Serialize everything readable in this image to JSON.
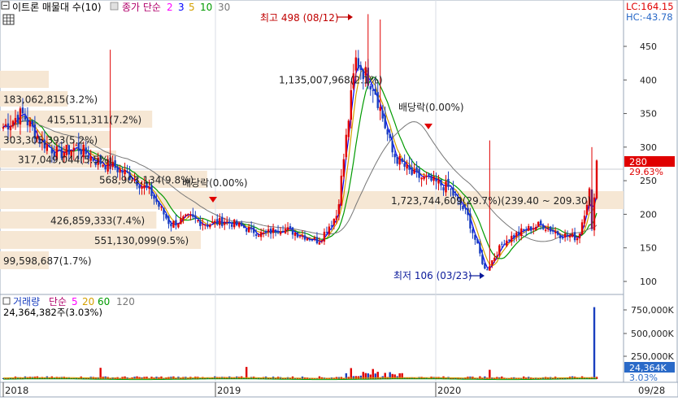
{
  "header": {
    "title": "이트론 매물대 수(10)",
    "ma_title": "종가 단순",
    "ma_periods": [
      "2",
      "3",
      "5",
      "10",
      "30"
    ],
    "ma_colors": [
      "#ff00ff",
      "#0000ff",
      "#d4a000",
      "#009a00",
      "#777777"
    ],
    "lc": "LC:164.15",
    "hc": "HC:-43.78"
  },
  "price_panel": {
    "y_ticks": [
      "450",
      "400",
      "350",
      "300",
      "250",
      "200",
      "150",
      "100"
    ],
    "current_price": "280",
    "current_change": "29.63%",
    "high_label": "최고 498 (08/12)",
    "low_label": "최저 106 (03/23)",
    "dividend_label": "배당락(0.00%)",
    "volume_profile": [
      {
        "label": "1,135,007,968(2.1%)",
        "level": 390
      },
      {
        "label": "183,062,815(3.2%)",
        "level": 365
      },
      {
        "label": "415,511,311(7.2%)",
        "level": 340
      },
      {
        "label": "303,305,393(5.2%)",
        "level": 315
      },
      {
        "label": "317,049,044(5.5%)",
        "level": 290
      },
      {
        "label": "568,903,134(9.8%)",
        "level": 265
      },
      {
        "label": "1,723,744,609(29.7%)(239.40 ~ 209.30)",
        "level": 240
      },
      {
        "label": "426,859,333(7.4%)",
        "level": 215
      },
      {
        "label": "551,130,099(9.5%)",
        "level": 190
      },
      {
        "label": "99,598,687(1.7%)",
        "level": 165
      }
    ]
  },
  "volume_panel": {
    "title": "거래량",
    "ma_title": "단순",
    "ma_periods": [
      "5",
      "20",
      "60",
      "120"
    ],
    "ma_colors": [
      "#ff00ff",
      "#d4a000",
      "#009a00",
      "#777777"
    ],
    "summary": "24,364,382주(3.03%)",
    "y_ticks": [
      "750,000K",
      "500,000K",
      "250,000K"
    ],
    "current_volume": "24,364K",
    "current_pct": "3.03%"
  },
  "x_axis": {
    "labels": [
      "2018",
      "2019",
      "2020",
      "09/28"
    ]
  },
  "chart_data": {
    "type": "candlestick",
    "title": "이트론",
    "ylim": [
      80,
      510
    ],
    "x_labels": [
      "2018",
      "2019",
      "2020",
      "09/28"
    ],
    "price_series": {
      "name": "종가",
      "points": [
        {
          "x": "2018-01",
          "y": 330
        },
        {
          "x": "2018-02",
          "y": 350
        },
        {
          "x": "2018-03",
          "y": 310
        },
        {
          "x": "2018-04",
          "y": 290
        },
        {
          "x": "2018-05",
          "y": 300
        },
        {
          "x": "2018-06",
          "y": 280
        },
        {
          "x": "2018-07",
          "y": 270
        },
        {
          "x": "2018-08",
          "y": 255
        },
        {
          "x": "2018-09",
          "y": 230
        },
        {
          "x": "2018-10",
          "y": 185
        },
        {
          "x": "2018-11",
          "y": 195
        },
        {
          "x": "2018-12",
          "y": 185
        },
        {
          "x": "2019-01",
          "y": 190
        },
        {
          "x": "2019-02",
          "y": 180
        },
        {
          "x": "2019-03",
          "y": 170
        },
        {
          "x": "2019-04",
          "y": 180
        },
        {
          "x": "2019-05",
          "y": 170
        },
        {
          "x": "2019-06",
          "y": 160
        },
        {
          "x": "2019-07",
          "y": 200
        },
        {
          "x": "2019-08",
          "y": 430
        },
        {
          "x": "2019-09",
          "y": 390
        },
        {
          "x": "2019-10",
          "y": 290
        },
        {
          "x": "2019-11",
          "y": 260
        },
        {
          "x": "2019-12",
          "y": 250
        },
        {
          "x": "2020-01",
          "y": 240
        },
        {
          "x": "2020-02",
          "y": 200
        },
        {
          "x": "2020-03",
          "y": 115
        },
        {
          "x": "2020-04",
          "y": 160
        },
        {
          "x": "2020-05",
          "y": 175
        },
        {
          "x": "2020-06",
          "y": 185
        },
        {
          "x": "2020-07",
          "y": 170
        },
        {
          "x": "2020-08",
          "y": 165
        },
        {
          "x": "2020-09",
          "y": 280
        }
      ]
    },
    "annotations": [
      {
        "label": "최고 498 (08/12)",
        "x": "2019-08-12",
        "y": 498
      },
      {
        "label": "최저 106 (03/23)",
        "x": "2020-03-23",
        "y": 106
      }
    ],
    "volume_profile": [
      {
        "volume": "99,598,687",
        "pct": 1.7
      },
      {
        "volume": "551,130,099",
        "pct": 9.5
      },
      {
        "volume": "426,859,333",
        "pct": 7.4
      },
      {
        "volume": "1,723,744,609",
        "pct": 29.7,
        "range": [
          209.3,
          239.4
        ]
      },
      {
        "volume": "568,903,134",
        "pct": 9.8
      },
      {
        "volume": "317,049,044",
        "pct": 5.5
      },
      {
        "volume": "303,305,393",
        "pct": 5.2
      },
      {
        "volume": "415,511,311",
        "pct": 7.2
      },
      {
        "volume": "183,062,815",
        "pct": 3.2
      },
      {
        "volume": "1,135,007,968",
        "pct": 2.1
      }
    ],
    "volume_ylim": [
      0,
      800000
    ],
    "volume_unit": "K",
    "last_volume": 24364
  }
}
